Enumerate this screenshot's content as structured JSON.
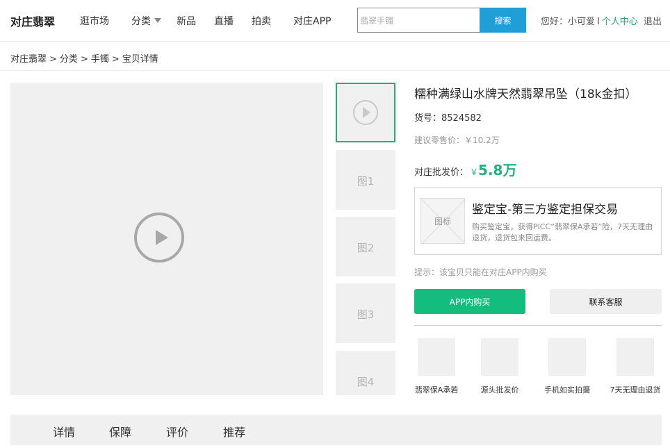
{
  "header": {
    "logo": "对庄翡翠",
    "nav": [
      "逛市场",
      "分类",
      "新品",
      "直播",
      "拍卖",
      "对庄APP"
    ],
    "search": {
      "value": "翡翠手镯",
      "button": "搜索"
    },
    "user": {
      "greeting": "您好：小可爱",
      "separator": "I",
      "center": "个人中心",
      "logout": "退出"
    }
  },
  "breadcrumb": [
    "对庄翡翠",
    "分类",
    "手镯",
    "宝贝详情"
  ],
  "breadcrumb_sep": ">",
  "media": {
    "thumbnails": [
      "图1",
      "图2",
      "图3",
      "图4"
    ]
  },
  "product": {
    "title": "糯种满绿山水牌天然翡翠吊坠（18k金扣）",
    "sku": "货号：8524582",
    "retail": "建议零售价：￥10.2万",
    "wholesale_label": "对庄批发价：",
    "currency": "￥",
    "wholesale_price": "5.8万"
  },
  "guarantee": {
    "icon_text": "图标",
    "title": "鉴定宝-第三方鉴定担保交易",
    "desc": "购买鉴定宝，获得PICC“翡翠保A承若”险，7天无理由退货，退货包来回运费。"
  },
  "tip": "提示：该宝贝只能在对庄APP内购买",
  "buttons": {
    "app": "APP内购买",
    "service": "联系客服"
  },
  "features": [
    "翡翠保A承若",
    "源头批发价",
    "手机如实拍摄",
    "7天无理由退货"
  ],
  "tabs": [
    "详情",
    "保障",
    "评价",
    "推荐"
  ],
  "colors": {
    "accent_green": "#12bd7d",
    "search_blue": "#1e9fd8",
    "link_green": "#1ea36e"
  }
}
